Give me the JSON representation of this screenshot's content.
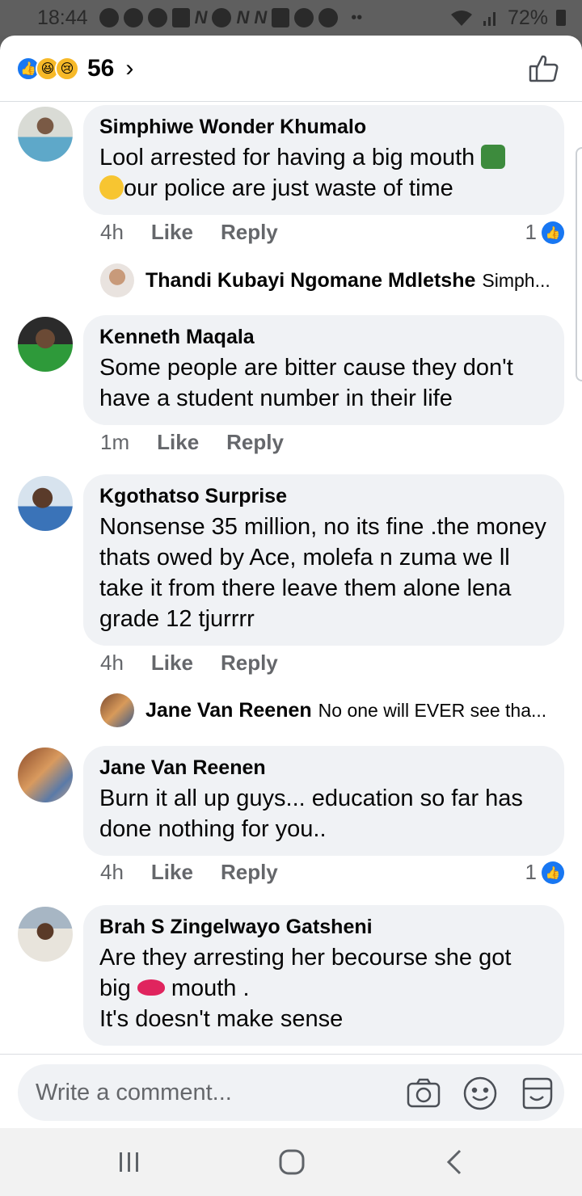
{
  "status_bar": {
    "time": "18:44",
    "battery": "72%"
  },
  "header": {
    "reaction_count": "56",
    "chevron": "›"
  },
  "comments": [
    {
      "author": "Simphiwe Wonder Khumalo",
      "text_line1": "Lool arrested for having a big mouth",
      "text_line2": "our police are just waste of time",
      "time": "4h",
      "like_label": "Like",
      "reply_label": "Reply",
      "likes": "1",
      "reply": {
        "author": "Thandi Kubayi Ngomane Mdletshe",
        "snippet": "Simph..."
      }
    },
    {
      "author": "Kenneth Maqala",
      "text": "Some people are bitter cause they don't have a student number in their life",
      "time": "1m",
      "like_label": "Like",
      "reply_label": "Reply"
    },
    {
      "author": "Kgothatso Surprise",
      "text": "Nonsense 35 million, no its fine .the money thats owed by Ace, molefa n zuma we ll take it from there leave them alone lena grade 12 tjurrrr",
      "time": "4h",
      "like_label": "Like",
      "reply_label": "Reply",
      "reply": {
        "author": "Jane Van Reenen",
        "snippet": "No one will EVER see tha..."
      }
    },
    {
      "author": "Jane Van Reenen",
      "text": "Burn it all up guys... education so far has done nothing for you..",
      "time": "4h",
      "like_label": "Like",
      "reply_label": "Reply",
      "likes": "1"
    },
    {
      "author": "Brah S Zingelwayo Gatsheni",
      "text_line1": "Are they arresting her becourse she got",
      "text_line2a": "big",
      "text_line2b": "mouth .",
      "text_line3": "It's doesn't make sense"
    }
  ],
  "composer": {
    "placeholder": "Write a comment..."
  },
  "colors": {
    "facebook_blue": "#1877f2",
    "bubble_bg": "#f0f2f5",
    "secondary_text": "#65676b"
  }
}
